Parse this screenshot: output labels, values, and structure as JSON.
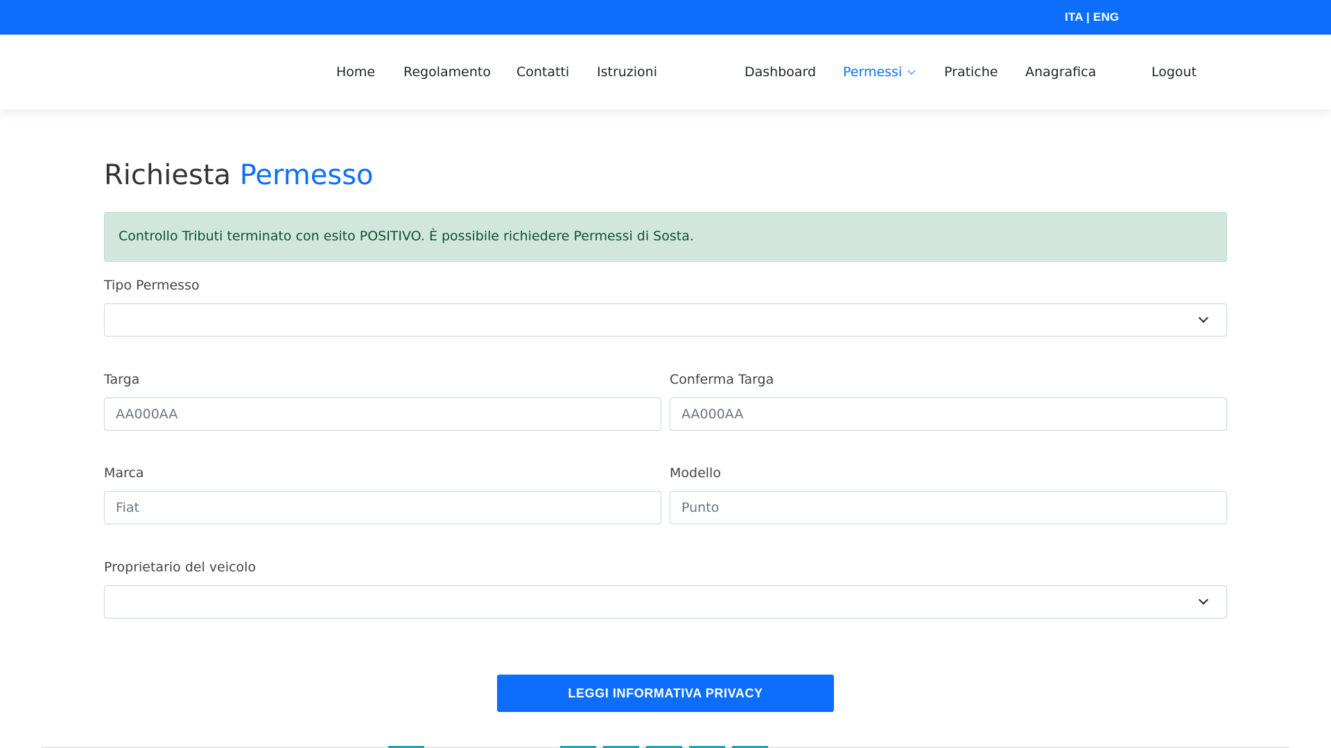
{
  "topbar": {
    "lang_ita": "ITA",
    "lang_sep": " | ",
    "lang_eng": "ENG"
  },
  "nav": {
    "home": "Home",
    "regolamento": "Regolamento",
    "contatti": "Contatti",
    "istruzioni": "Istruzioni",
    "dashboard": "Dashboard",
    "permessi": "Permessi",
    "pratiche": "Pratiche",
    "anagrafica": "Anagrafica",
    "logout": "Logout"
  },
  "page": {
    "title_main": "Richiesta",
    "title_accent": "Permesso",
    "alert": "Controllo Tributi terminato con esito POSITIVO. È possibile richiedere Permessi di Sosta."
  },
  "form": {
    "tipo_permesso": {
      "label": "Tipo Permesso",
      "value": ""
    },
    "targa": {
      "label": "Targa",
      "placeholder": "AA000AA"
    },
    "conferma_targa": {
      "label": "Conferma Targa",
      "placeholder": "AA000AA"
    },
    "marca": {
      "label": "Marca",
      "placeholder": "Fiat"
    },
    "modello": {
      "label": "Modello",
      "placeholder": "Punto"
    },
    "proprietario": {
      "label": "Proprietario del veicolo",
      "value": ""
    },
    "privacy_button": "LEGGI INFORMATIVA PRIVACY"
  },
  "colors": {
    "primary": "#0d6efd",
    "alert_bg": "#d1e7dd",
    "alert_text": "#0f5132"
  }
}
